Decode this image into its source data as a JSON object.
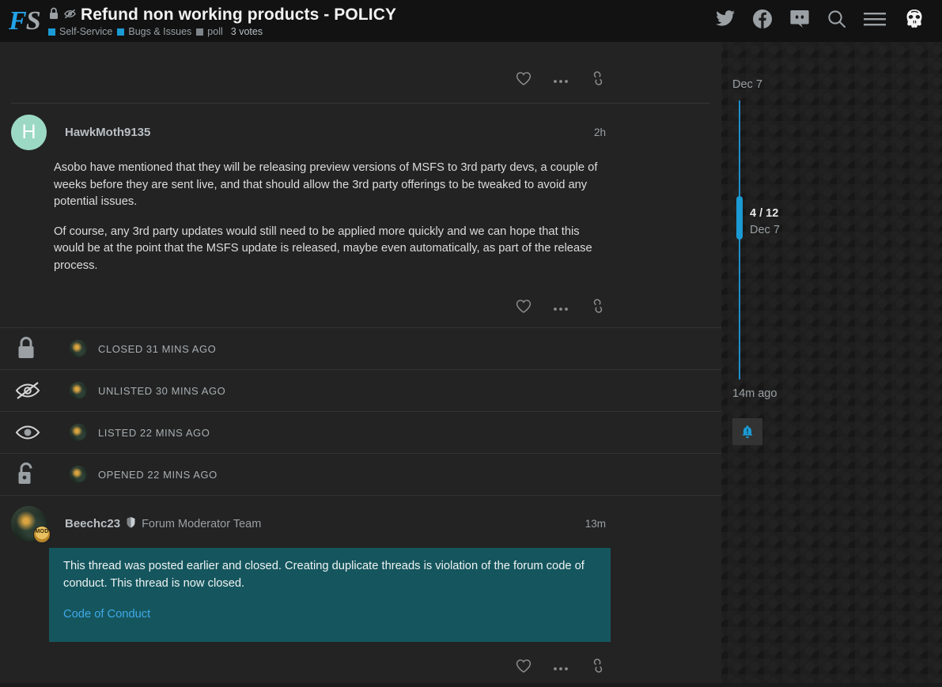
{
  "header": {
    "logo": {
      "part1": "F",
      "part2": "S"
    },
    "status_icons": [
      "lock-icon",
      "eye-slash-icon"
    ],
    "title": "Refund non working products - POLICY",
    "categories": [
      {
        "label": "Self-Service",
        "color": "#1b9ad4"
      },
      {
        "label": "Bugs & Issues",
        "color": "#1b9ad4"
      },
      {
        "label": "poll",
        "color": "#7f8589"
      }
    ],
    "votes": "3 votes",
    "icons": [
      "twitter-icon",
      "facebook-icon",
      "discord-icon",
      "search-icon",
      "hamburger-menu-icon",
      "user-avatar-skull"
    ]
  },
  "top_actions": {
    "like": "like-icon",
    "more": "more-options-icon",
    "share": "share-link-icon"
  },
  "posts": [
    {
      "avatar_letter": "H",
      "avatar_color": "#9bd9c4",
      "username": "HawkMoth9135",
      "timestamp": "2h",
      "paragraphs": [
        "Asobo have mentioned that they will be releasing preview versions of MSFS to 3rd party devs, a couple of weeks before they are sent live, and that should allow the 3rd party offerings to be tweaked to avoid any potential issues.",
        "Of course, any 3rd party updates would still need to be applied more quickly and we can hope that this would be at the point that the MSFS update is released, maybe even automatically, as part of the release process."
      ]
    }
  ],
  "moderation_log": [
    {
      "icon": "lock-closed-icon",
      "text": "CLOSED 31 MINS AGO"
    },
    {
      "icon": "eye-slash-icon",
      "text": "UNLISTED 30 MINS AGO"
    },
    {
      "icon": "eye-icon",
      "text": "LISTED 22 MINS AGO"
    },
    {
      "icon": "lock-open-icon",
      "text": "OPENED 22 MINS AGO"
    }
  ],
  "mod_post": {
    "username": "Beechc23",
    "badge_icon": "shield-icon",
    "mod_flair": "MOD",
    "user_title": "Forum Moderator Team",
    "timestamp": "13m",
    "quote_text": "This thread was posted earlier and closed. Creating duplicate threads is violation of the forum code of conduct. This thread is now closed.",
    "quote_link": "Code of Conduct",
    "quote_bg": "#15565e"
  },
  "timeline": {
    "top_date": "Dec 7",
    "position": "4 / 12",
    "position_date": "Dec 7",
    "bottom_date": "14m ago",
    "accent": "#1b9ad4",
    "bell_icon": "notification-bell-icon"
  }
}
